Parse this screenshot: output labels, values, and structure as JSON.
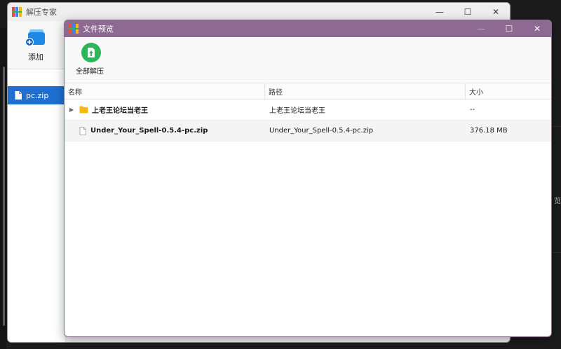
{
  "back_window": {
    "title": "解压专家",
    "toolbar": {
      "add_label": "添加"
    },
    "sidebar": {
      "items": [
        {
          "label": "pc.zip"
        }
      ]
    },
    "controls": {
      "minimize": "—",
      "maximize": "☐",
      "close": "✕"
    }
  },
  "front_window": {
    "title": "文件预览",
    "toolbar": {
      "extract_all_label": "全部解压"
    },
    "controls": {
      "minimize": "—",
      "maximize": "☐",
      "close": "✕"
    },
    "table": {
      "headers": {
        "name": "名称",
        "path": "路径",
        "size": "大小"
      },
      "rows": [
        {
          "type": "folder",
          "name": "上老王论坛当老王",
          "path": "上老王论坛当老王",
          "size": "--"
        },
        {
          "type": "file",
          "name": "Under_Your_Spell-0.5.4-pc.zip",
          "path": "Under_Your_Spell-0.5.4-pc.zip",
          "size": "376.18 MB"
        }
      ]
    }
  },
  "desktop": {
    "edge_text": "览"
  },
  "colors": {
    "front_titlebar": "#8e6a92",
    "selection": "#1e6fd0",
    "extract_green": "#2cb65a",
    "folder": "#f5b90f"
  }
}
